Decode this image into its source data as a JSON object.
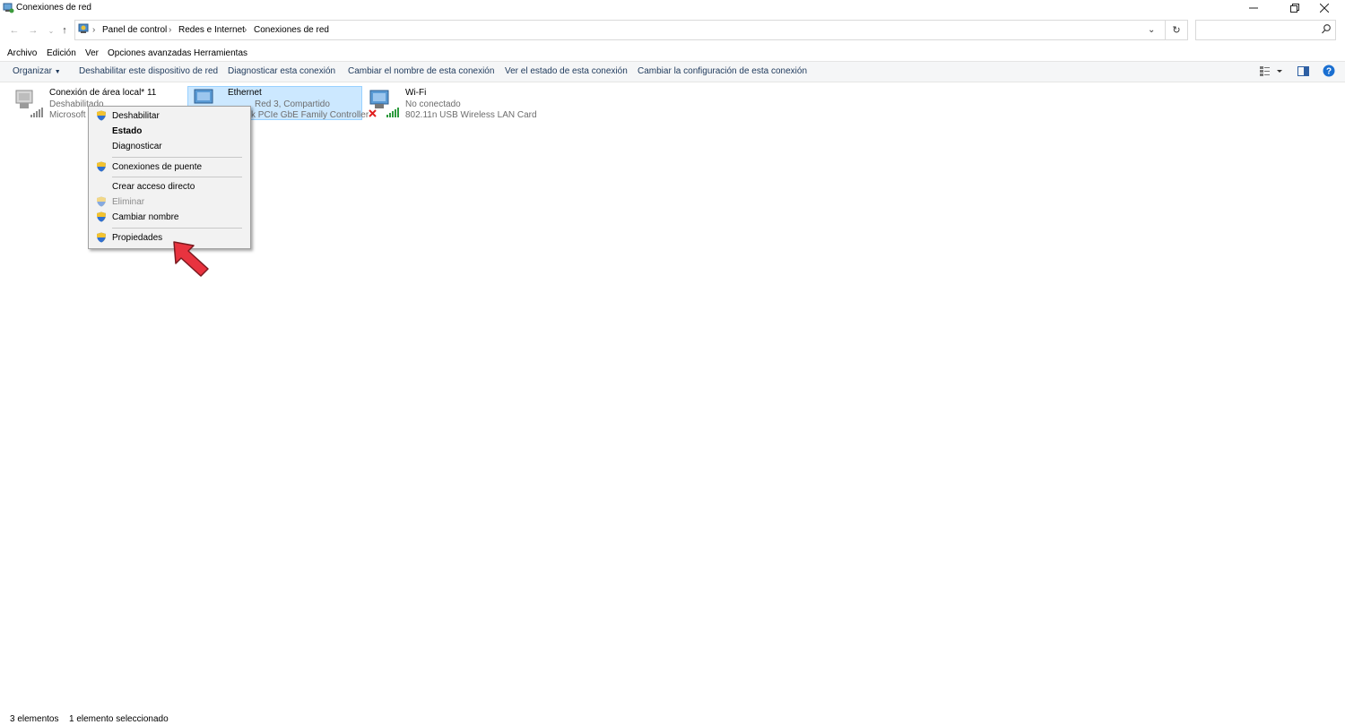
{
  "window": {
    "title": "Conexiones de red",
    "minimize_icon": "minimize-icon",
    "restore_icon": "restore-icon",
    "close_icon": "close-icon"
  },
  "address_bar": {
    "breadcrumbs": [
      "Panel de control",
      "Redes e Internet",
      "Conexiones de red"
    ],
    "search_placeholder": ""
  },
  "menu_bar": [
    "Archivo",
    "Edición",
    "Ver",
    "Opciones avanzadas",
    "Herramientas"
  ],
  "command_bar": {
    "organize": "Organizar",
    "commands": [
      "Deshabilitar este dispositivo de red",
      "Diagnosticar esta conexión",
      "Cambiar el nombre de esta conexión",
      "Ver el estado de esta conexión",
      "Cambiar la configuración de esta conexión"
    ]
  },
  "connections": [
    {
      "name": "Conexión de área local* 11",
      "status": "Deshabilitado",
      "device": "Microsoft"
    },
    {
      "name": "Ethernet",
      "status": "Red 3, Compartido",
      "device": "k PCIe GbE Family Controller"
    },
    {
      "name": "Wi-Fi",
      "status": "No conectado",
      "device": "802.11n USB Wireless LAN Card"
    }
  ],
  "context_menu": {
    "items": [
      {
        "label": "Deshabilitar",
        "shield": true
      },
      {
        "label": "Estado",
        "bold": true
      },
      {
        "label": "Diagnosticar"
      },
      {
        "label": "Conexiones de puente",
        "shield": true
      },
      {
        "label": "Crear acceso directo"
      },
      {
        "label": "Eliminar",
        "shield": true,
        "disabled": true
      },
      {
        "label": "Cambiar nombre",
        "shield": true
      },
      {
        "label": "Propiedades",
        "shield": true
      }
    ]
  },
  "status_bar": {
    "count": "3 elementos",
    "selected": "1 elemento seleccionado"
  },
  "colors": {
    "selection_bg": "#cce8ff",
    "arrow": "#e8333f"
  }
}
